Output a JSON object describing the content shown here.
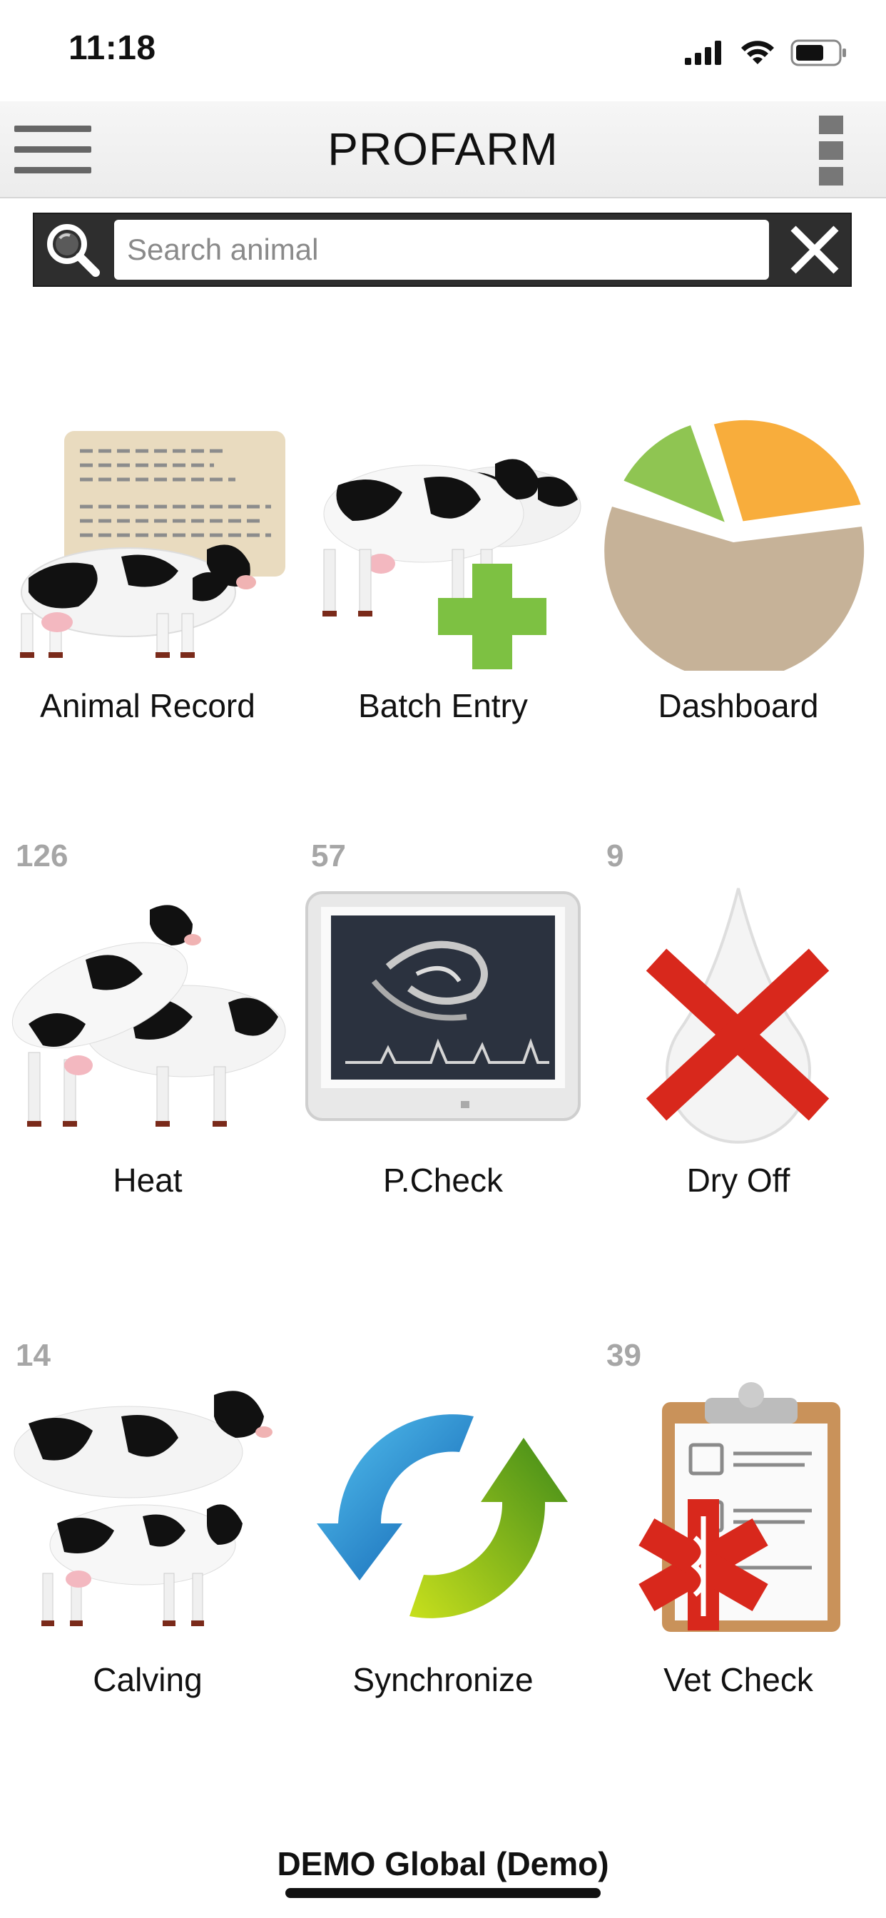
{
  "status_bar": {
    "time": "11:18",
    "icons": [
      "signal-icon",
      "wifi-icon",
      "battery-icon"
    ]
  },
  "app_bar": {
    "title": "PROFARM",
    "menu_icon": "hamburger-menu-icon",
    "overflow_icon": "overflow-menu-icon"
  },
  "search": {
    "placeholder": "Search animal",
    "value": "",
    "search_icon": "search-icon",
    "clear_icon": "close-icon"
  },
  "tiles": [
    {
      "label": "Animal Record",
      "count": "",
      "icon": "animal-record-icon"
    },
    {
      "label": "Batch Entry",
      "count": "",
      "icon": "batch-entry-icon"
    },
    {
      "label": "Dashboard",
      "count": "",
      "icon": "pie-chart-icon"
    },
    {
      "label": "Heat",
      "count": "126",
      "icon": "heat-icon"
    },
    {
      "label": "P.Check",
      "count": "57",
      "icon": "ultrasound-monitor-icon"
    },
    {
      "label": "Dry Off",
      "count": "9",
      "icon": "dry-off-icon"
    },
    {
      "label": "Calving",
      "count": "14",
      "icon": "calving-icon"
    },
    {
      "label": "Synchronize",
      "count": "",
      "icon": "sync-icon"
    },
    {
      "label": "Vet Check",
      "count": "39",
      "icon": "vet-check-icon"
    }
  ],
  "footer": {
    "farm_name": "DEMO Global (Demo)"
  },
  "colors": {
    "app_bar_bg": "#efefef",
    "search_bar_bg": "#2e2e2e",
    "count_text": "#a6a6a6",
    "pie_green": "#8fc552",
    "pie_orange": "#f8ad3c",
    "pie_tan": "#c6b298",
    "plus_green": "#7dc142",
    "cross_red": "#d8281c"
  }
}
